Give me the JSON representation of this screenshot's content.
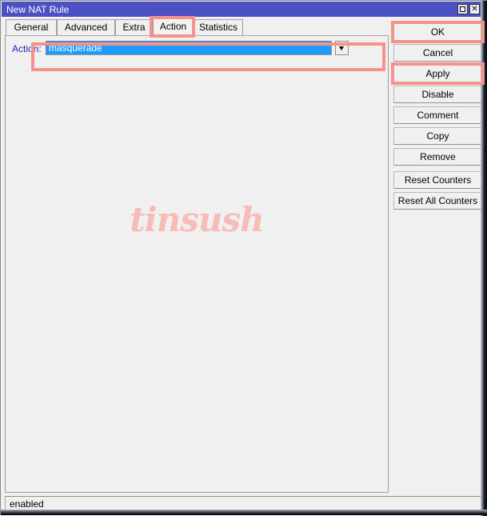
{
  "window": {
    "title": "New NAT Rule",
    "controls": [
      {
        "name": "maximize",
        "glyph": ""
      },
      {
        "name": "close",
        "glyph": "✕"
      }
    ]
  },
  "tabs": [
    {
      "label": "General",
      "active": false
    },
    {
      "label": "Advanced",
      "active": false
    },
    {
      "label": "Extra",
      "active": false
    },
    {
      "label": "Action",
      "active": true
    },
    {
      "label": "Statistics",
      "active": false
    }
  ],
  "form": {
    "action": {
      "label": "Action:",
      "value": "masquerade",
      "placeholder": "",
      "dropdown_icon": "chevron-down-icon"
    }
  },
  "watermark": {
    "text": "tinsush"
  },
  "buttons": [
    {
      "label": "OK",
      "highlighted": true,
      "gap_above": false
    },
    {
      "label": "Cancel",
      "highlighted": false,
      "gap_above": false
    },
    {
      "label": "Apply",
      "highlighted": true,
      "gap_above": false
    },
    {
      "label": "Disable",
      "highlighted": false,
      "gap_above": false
    },
    {
      "label": "Comment",
      "highlighted": false,
      "gap_above": false
    },
    {
      "label": "Copy",
      "highlighted": false,
      "gap_above": false
    },
    {
      "label": "Remove",
      "highlighted": false,
      "gap_above": false
    },
    {
      "label": "Reset Counters",
      "highlighted": false,
      "gap_above": true
    },
    {
      "label": "Reset All Counters",
      "highlighted": false,
      "gap_above": false
    }
  ],
  "statusbar": {
    "text": "enabled"
  },
  "colors": {
    "titlebar": "#4b51c2",
    "titlebar_text": "#ffffff",
    "window_bg": "#f0f0f0",
    "field_label": "#1c1cc0",
    "selection": "#1d9bf8",
    "selection_text": "#ffffff",
    "annotation": "#f6928c",
    "watermark": "#f7bcb6"
  }
}
